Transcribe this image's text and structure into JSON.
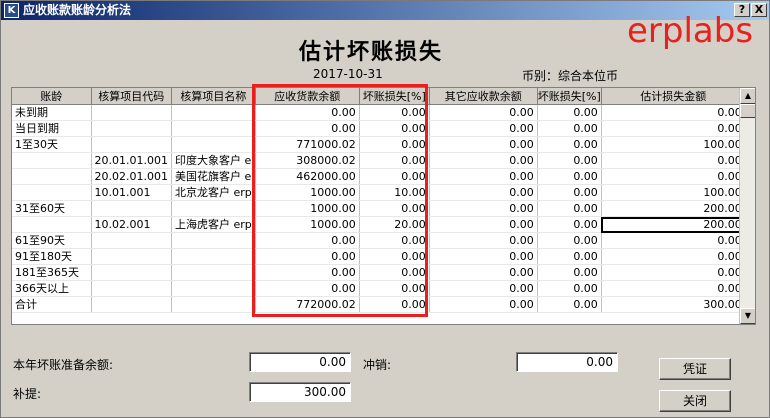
{
  "window": {
    "title": "应收账款账龄分析法",
    "icon_glyph": "K",
    "help_glyph": "?",
    "close_glyph": "X"
  },
  "watermark": "erplabs",
  "report": {
    "title": "估计坏账损失",
    "date": "2017-10-31",
    "currency_label": "币别：综合本位币"
  },
  "grid": {
    "columns": [
      "账龄",
      "核算项目代码",
      "核算项目名称",
      "应收货款余额",
      "坏账损失[%]",
      "其它应收款余额",
      "坏账损失[%]",
      "估计损失金额"
    ],
    "rows": [
      [
        "未到期",
        "",
        "",
        "0.00",
        "0.00",
        "0.00",
        "0.00",
        "0.00"
      ],
      [
        "当日到期",
        "",
        "",
        "0.00",
        "0.00",
        "0.00",
        "0.00",
        "0.00"
      ],
      [
        "1至30天",
        "",
        "",
        "771000.02",
        "0.00",
        "0.00",
        "0.00",
        "100.00"
      ],
      [
        "",
        "20.01.01.001",
        "印度大象客户 e",
        "308000.02",
        "0.00",
        "0.00",
        "0.00",
        "0.00"
      ],
      [
        "",
        "20.02.01.001",
        "美国花旗客户 e",
        "462000.00",
        "0.00",
        "0.00",
        "0.00",
        "0.00"
      ],
      [
        "",
        "10.01.001",
        "北京龙客户 erp",
        "1000.00",
        "10.00",
        "0.00",
        "0.00",
        "100.00"
      ],
      [
        "31至60天",
        "",
        "",
        "1000.00",
        "0.00",
        "0.00",
        "0.00",
        "200.00"
      ],
      [
        "",
        "10.02.001",
        "上海虎客户 erp",
        "1000.00",
        "20.00",
        "0.00",
        "0.00",
        "200.00"
      ],
      [
        "61至90天",
        "",
        "",
        "0.00",
        "0.00",
        "0.00",
        "0.00",
        "0.00"
      ],
      [
        "91至180天",
        "",
        "",
        "0.00",
        "0.00",
        "0.00",
        "0.00",
        "0.00"
      ],
      [
        "181至365天",
        "",
        "",
        "0.00",
        "0.00",
        "0.00",
        "0.00",
        "0.00"
      ],
      [
        "366天以上",
        "",
        "",
        "0.00",
        "0.00",
        "0.00",
        "0.00",
        "0.00"
      ],
      [
        "合计",
        "",
        "",
        "772000.02",
        "0.00",
        "0.00",
        "0.00",
        "300.00"
      ]
    ]
  },
  "form": {
    "reserve_label": "本年坏账准备余额:",
    "reserve_value": "0.00",
    "writeoff_label": "冲销:",
    "writeoff_value": "0.00",
    "supplement_label": "补提:",
    "supplement_value": "300.00"
  },
  "buttons": {
    "voucher": "凭证",
    "close": "关闭"
  }
}
